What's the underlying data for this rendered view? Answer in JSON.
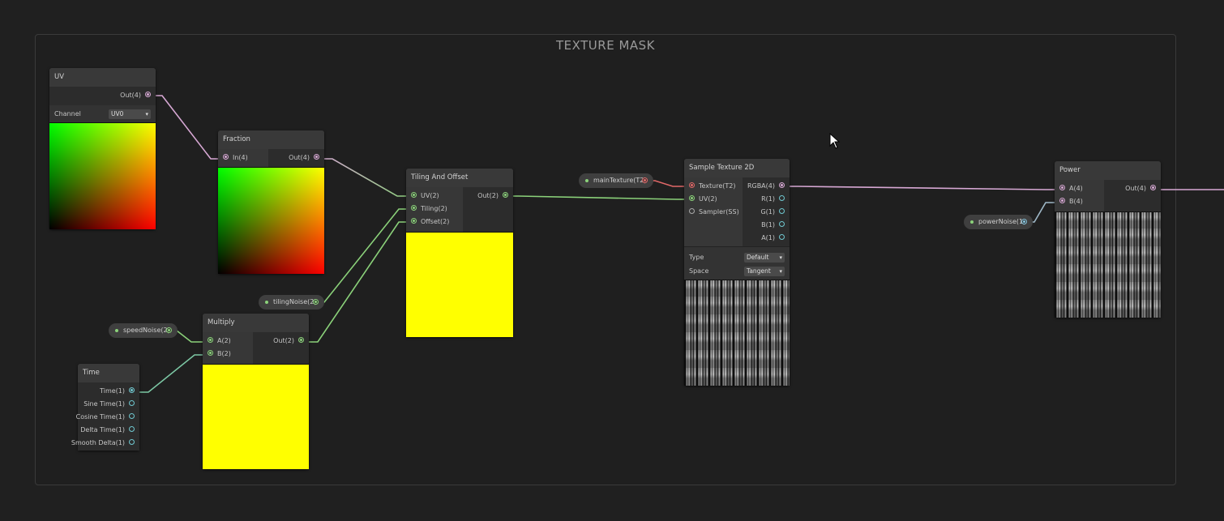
{
  "group": {
    "title": "TEXTURE MASK"
  },
  "uv": {
    "title": "UV",
    "out": "Out(4)",
    "channel_label": "Channel",
    "channel_value": "UV0"
  },
  "fraction": {
    "title": "Fraction",
    "in": "In(4)",
    "out": "Out(4)"
  },
  "tiling": {
    "title": "Tiling And Offset",
    "inputs": [
      "UV(2)",
      "Tiling(2)",
      "Offset(2)"
    ],
    "out": "Out(2)"
  },
  "sample": {
    "title": "Sample Texture 2D",
    "inputs": [
      "Texture(T2)",
      "UV(2)",
      "Sampler(SS)"
    ],
    "outputs": [
      "RGBA(4)",
      "R(1)",
      "G(1)",
      "B(1)",
      "A(1)"
    ],
    "type_label": "Type",
    "type_value": "Default",
    "space_label": "Space",
    "space_value": "Tangent"
  },
  "power": {
    "title": "Power",
    "inputs": [
      "A(4)",
      "B(4)"
    ],
    "out": "Out(4)"
  },
  "multiply": {
    "title": "Multiply",
    "inputs": [
      "A(2)",
      "B(2)"
    ],
    "out": "Out(2)"
  },
  "time": {
    "title": "Time",
    "outputs": [
      "Time(1)",
      "Sine Time(1)",
      "Cosine Time(1)",
      "Delta Time(1)",
      "Smooth Delta(1)"
    ]
  },
  "properties": {
    "mainTexture": "mainTexture(T2)",
    "tilingNoise": "tilingNoise(2)",
    "speedNoise": "speedNoise(2)",
    "powerNoise": "powerNoise(1)"
  },
  "colors": {
    "vector4": "#d7a8d4",
    "vector2": "#8bd27a",
    "texture": "#e06868",
    "float": "#6fc8d0",
    "background": "#202020"
  }
}
